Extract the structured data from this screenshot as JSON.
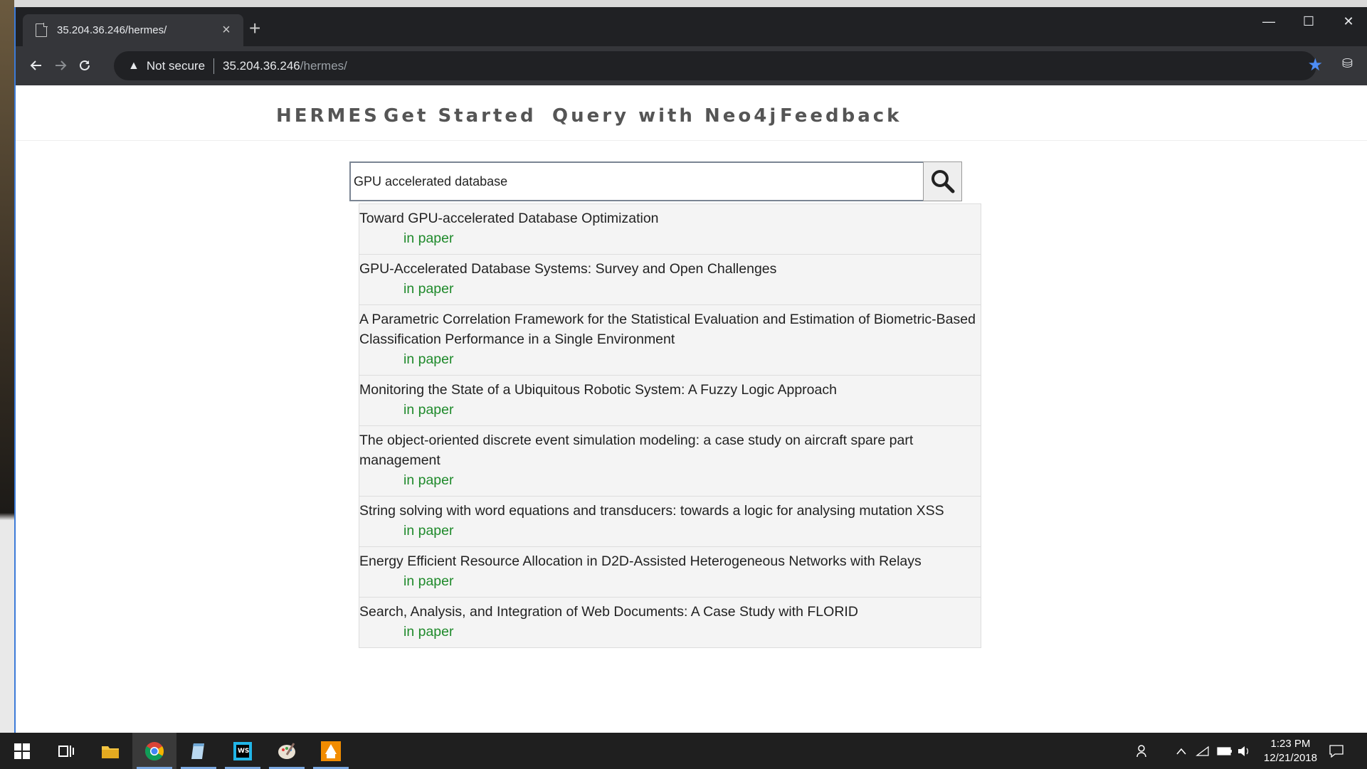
{
  "browser": {
    "tab_title": "35.204.36.246/hermes/",
    "tab_close": "×",
    "new_tab": "+",
    "window_controls": {
      "minimize": "—",
      "maximize": "☐",
      "close": "✕"
    },
    "security_label": "Not secure",
    "url_host": "35.204.36.246",
    "url_path": "/hermes/"
  },
  "nav": {
    "brand": "HERMES",
    "items": [
      "Get Started",
      "Query with Neo4j",
      "Feedback"
    ]
  },
  "search": {
    "value": "GPU accelerated database"
  },
  "results": [
    {
      "title": "Toward GPU-accelerated Database Optimization",
      "source": "in paper"
    },
    {
      "title": "GPU-Accelerated Database Systems: Survey and Open Challenges",
      "source": "in paper"
    },
    {
      "title": "A Parametric Correlation Framework for the Statistical Evaluation and Estimation of Biometric-Based Classification Performance in a Single Environment",
      "source": "in paper"
    },
    {
      "title": "Monitoring the State of a Ubiquitous Robotic System: A Fuzzy Logic Approach",
      "source": "in paper"
    },
    {
      "title": "The object-oriented discrete event simulation modeling: a case study on aircraft spare part management",
      "source": "in paper"
    },
    {
      "title": "String solving with word equations and transducers: towards a logic for analysing mutation XSS",
      "source": "in paper"
    },
    {
      "title": "Energy Efficient Resource Allocation in D2D-Assisted Heterogeneous Networks with Relays",
      "source": "in paper"
    },
    {
      "title": "Search, Analysis, and Integration of Web Documents: A Case Study with FLORID",
      "source": "in paper"
    }
  ],
  "taskbar": {
    "time": "1:23 PM",
    "date": "12/21/2018"
  },
  "colors": {
    "result_source": "#1f8a2b",
    "star": "#4d8df6"
  }
}
